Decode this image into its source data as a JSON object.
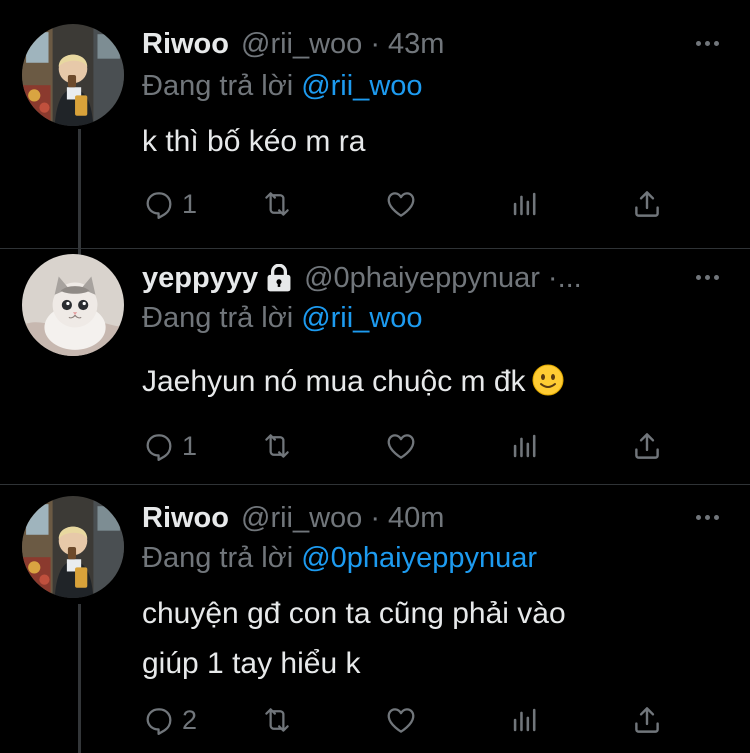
{
  "colors": {
    "background": "#000000",
    "text": "#e7e9ea",
    "secondary": "#71767b",
    "link": "#1d9bf0",
    "thread_line": "#333639"
  },
  "reply_label": "Đang trả lời",
  "tweets": [
    {
      "name": "Riwoo",
      "handle": "@rii_woo",
      "separator": "·",
      "time": "43m",
      "reply_to": "@rii_woo",
      "text": "k thì bố kéo m ra",
      "reply_count": "1",
      "icons": [
        "reply-icon",
        "retweet-icon",
        "like-icon",
        "analytics-icon",
        "share-icon"
      ]
    },
    {
      "name": "yeppyyy",
      "protected": true,
      "handle": "@0phaiyeppynuar",
      "separator": "·...",
      "time": "",
      "reply_to": "@rii_woo",
      "text": "Jaehyun nó mua chuộc m đk",
      "emoji": "slightly-smiling-face",
      "reply_count": "1",
      "icons": [
        "reply-icon",
        "retweet-icon",
        "like-icon",
        "analytics-icon",
        "share-icon"
      ]
    },
    {
      "name": "Riwoo",
      "handle": "@rii_woo",
      "separator": "·",
      "time": "40m",
      "reply_to": "@0phaiyeppynuar",
      "text_lines": [
        "chuyện gđ con ta cũng phải vào",
        "giúp 1 tay hiểu k"
      ],
      "reply_count": "2",
      "icons": [
        "reply-icon",
        "retweet-icon",
        "like-icon",
        "analytics-icon",
        "share-icon"
      ]
    }
  ]
}
